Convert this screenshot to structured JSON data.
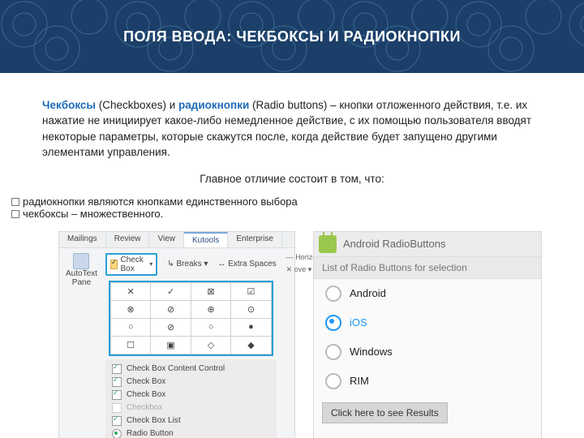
{
  "title": "ПОЛЯ ВВОДА: ЧЕКБОКСЫ И РАДИОКНОПКИ",
  "para": {
    "hl1": "Чекбоксы",
    "p1a": " (Checkboxes) и ",
    "hl2": "радиокнопки",
    "p1b": " (Radio buttons) – кнопки отложенного действия, т.е. их нажатие не инициирует какое-либо немедленное действие, с их помощью пользователя вводят некоторые параметры, которые скажутся после, когда действие будет запущено другими элементами управления."
  },
  "lead": "Главное отличие состоит в том, что:",
  "bullets": [
    "радиокнопки являются кнопками единственного выбора",
    "чекбоксы – множественного."
  ],
  "word": {
    "tabs": [
      "Mailings",
      "Review",
      "View",
      "Kutools",
      "Enterprise"
    ],
    "selected_tab": "Kutools",
    "autotext": "AutoText Pane",
    "checkbox_btn": "Check Box",
    "opts": [
      "Breaks",
      "Extra Spaces",
      "Horizontal Line",
      "ove"
    ],
    "list": [
      "Check Box Content Control",
      "Check Box",
      "Check Box",
      "Checkbox",
      "Check Box List",
      "Radio Button"
    ]
  },
  "android": {
    "title": "Android RadioButtons",
    "bar": "List of Radio Buttons for selection",
    "options": [
      "Android",
      "iOS",
      "Windows",
      "RIM"
    ],
    "selected": "iOS",
    "result_btn": "Click here to see Results"
  }
}
